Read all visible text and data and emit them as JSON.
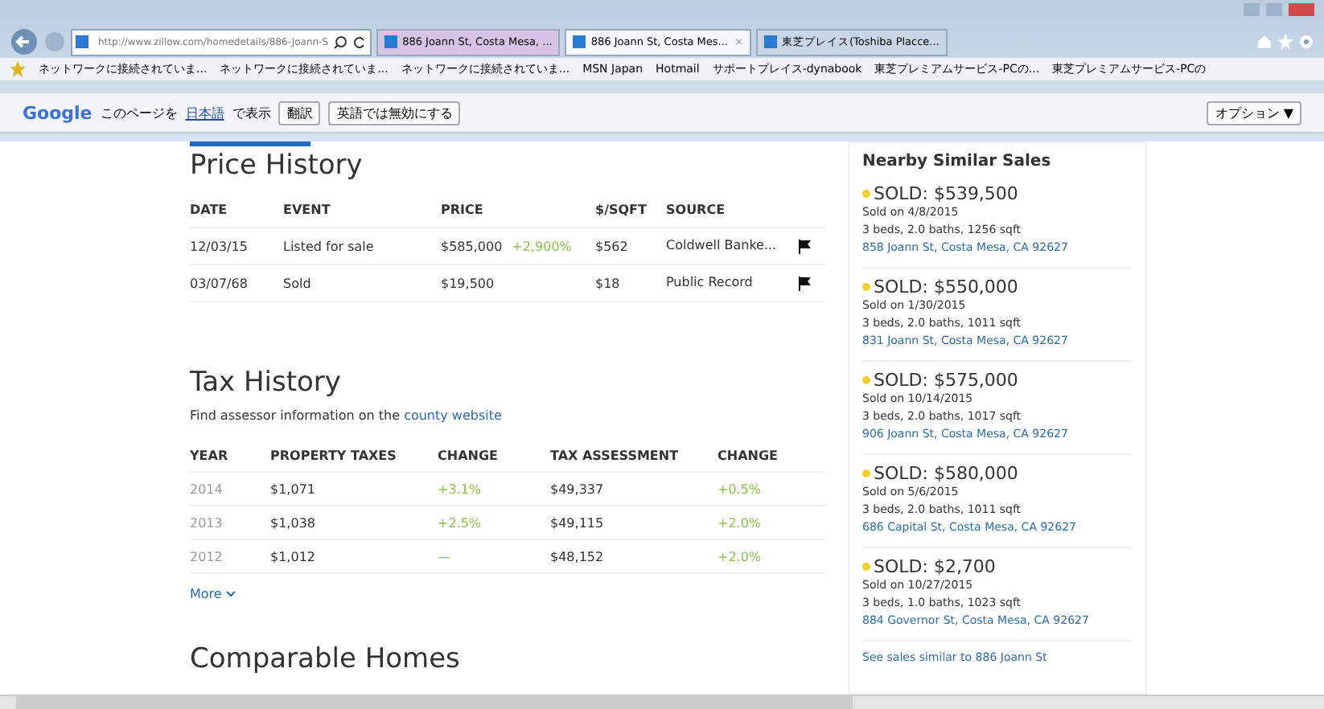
{
  "browser": {
    "address": "http://www.zillow.com/homedetails/886-Joann-S",
    "tabs": [
      {
        "label": "886 Joann St, Costa Mesa, ...",
        "selected": false
      },
      {
        "label": "886 Joann St, Costa Mes...",
        "selected": true,
        "close": "×"
      },
      {
        "label": "東芝プレイス(Toshiba Placce...",
        "selected": false
      }
    ],
    "favorites": [
      "ネットワークに接続されていま...",
      "ネットワークに接続されていま...",
      "ネットワークに接続されていま...",
      "MSN Japan",
      "Hotmail",
      "サポートプレイス-dynabook",
      "東芝プレミアムサービス-PCの...",
      "東芝プレミアムサービス-PCの"
    ],
    "translate_bar": {
      "logo": "Google",
      "before": "このページを",
      "language": "日本語",
      "after": "で表示",
      "translate": "翻訳",
      "never": "英語では無効にする",
      "options": "オプション ▼"
    }
  },
  "price_history": {
    "title": "Price History",
    "columns": [
      "DATE",
      "EVENT",
      "PRICE",
      "$/SQFT",
      "SOURCE"
    ],
    "rows": [
      {
        "date": "12/03/15",
        "event": "Listed for sale",
        "price": "$585,000",
        "change": "+2,900%",
        "sqft": "$562",
        "source": "Coldwell Banke..."
      },
      {
        "date": "03/07/68",
        "event": "Sold",
        "price": "$19,500",
        "change": "",
        "sqft": "$18",
        "source": "Public Record"
      }
    ]
  },
  "tax_history": {
    "title": "Tax History",
    "note": "Find assessor information on the",
    "link": "county website",
    "columns": [
      "YEAR",
      "PROPERTY TAXES",
      "CHANGE",
      "TAX ASSESSMENT",
      "CHANGE"
    ],
    "rows": [
      {
        "year": "2014",
        "taxes": "$1,071",
        "change": "+3.1%",
        "assessment": "$49,337",
        "assessment_change": "+0.5%"
      },
      {
        "year": "2013",
        "taxes": "$1,038",
        "change": "+2.5%",
        "assessment": "$49,115",
        "assessment_change": "+2.0%"
      },
      {
        "year": "2012",
        "taxes": "$1,012",
        "change": "—",
        "assessment": "$48,152",
        "assessment_change": "+2.0%"
      }
    ],
    "more": "More"
  },
  "comparable": {
    "title": "Comparable Homes"
  },
  "nearby": {
    "title": "Nearby Similar Sales",
    "items": [
      {
        "price": "SOLD: $539,500",
        "date": "Sold on 4/8/2015",
        "details": "3 beds, 2.0 baths, 1256 sqft",
        "address": "858 Joann St, Costa Mesa, CA 92627"
      },
      {
        "price": "SOLD: $550,000",
        "date": "Sold on 1/30/2015",
        "details": "3 beds, 2.0 baths, 1011 sqft",
        "address": "831 Joann St, Costa Mesa, CA 92627"
      },
      {
        "price": "SOLD: $575,000",
        "date": "Sold on 10/14/2015",
        "details": "3 beds, 2.0 baths, 1017 sqft",
        "address": "906 Joann St, Costa Mesa, CA 92627"
      },
      {
        "price": "SOLD: $580,000",
        "date": "Sold on 5/6/2015",
        "details": "3 beds, 2.0 baths, 1011 sqft",
        "address": "686 Capital St, Costa Mesa, CA 92627"
      },
      {
        "price": "SOLD: $2,700",
        "date": "Sold on 10/27/2015",
        "details": "3 beds, 1.0 baths, 1023 sqft",
        "address": "884 Governor St, Costa Mesa, CA 92627"
      }
    ],
    "see_all": "See sales similar to 886 Joann St"
  }
}
